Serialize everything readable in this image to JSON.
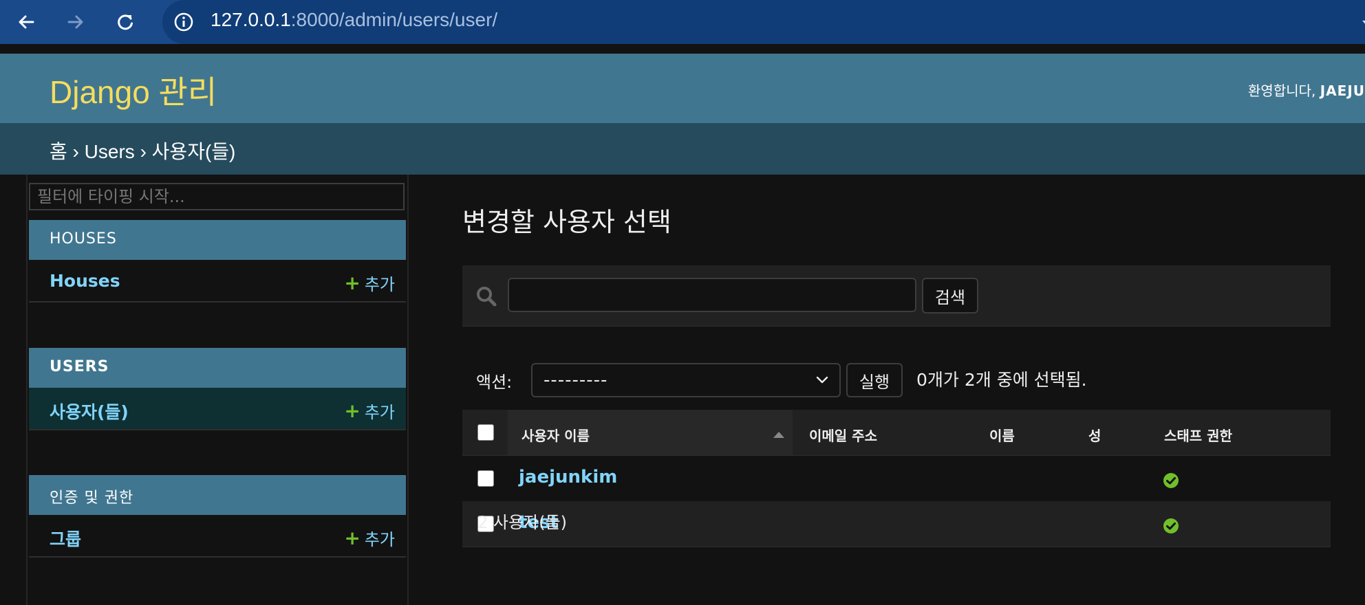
{
  "browser": {
    "url_host": "127.0.0.1",
    "url_path": ":8000/admin/users/user/"
  },
  "header": {
    "branding": "Django 관리",
    "welcome": "환영합니다, ",
    "username": "JAEJU"
  },
  "breadcrumbs": [
    "홈",
    "Users",
    "사용자(들)"
  ],
  "sidebar": {
    "filter_placeholder": "필터에 타이핑 시작...",
    "apps": [
      {
        "caption": "HOUSES",
        "model": "Houses",
        "add": "추가"
      },
      {
        "caption": "USERS",
        "model": "사용자(들)",
        "add": "추가"
      },
      {
        "caption": "인증 및 권한",
        "model": "그룹",
        "add": "추가"
      }
    ]
  },
  "content": {
    "title": "변경할 사용자 선택",
    "search_button": "검색",
    "actions_label": "액션:",
    "action_selected": "---------",
    "run_button": "실행",
    "selection_counter": "0개가 2개 중에 선택됨.",
    "columns": [
      "사용자 이름",
      "이메일 주소",
      "이름",
      "성",
      "스태프 권한"
    ],
    "rows": [
      {
        "username": "jaejunkim",
        "email": "",
        "first_name": "",
        "last_name": "",
        "is_staff": true
      },
      {
        "username": "test",
        "email": "",
        "first_name": "",
        "last_name": "",
        "is_staff": true
      }
    ],
    "paginator": "2 사용자(들)"
  },
  "colors": {
    "header": "#417690",
    "breadcrumbs": "#264b5d",
    "branding": "#f5dd5d",
    "link": "#81d4fa",
    "add_plus": "#70bf2b"
  }
}
